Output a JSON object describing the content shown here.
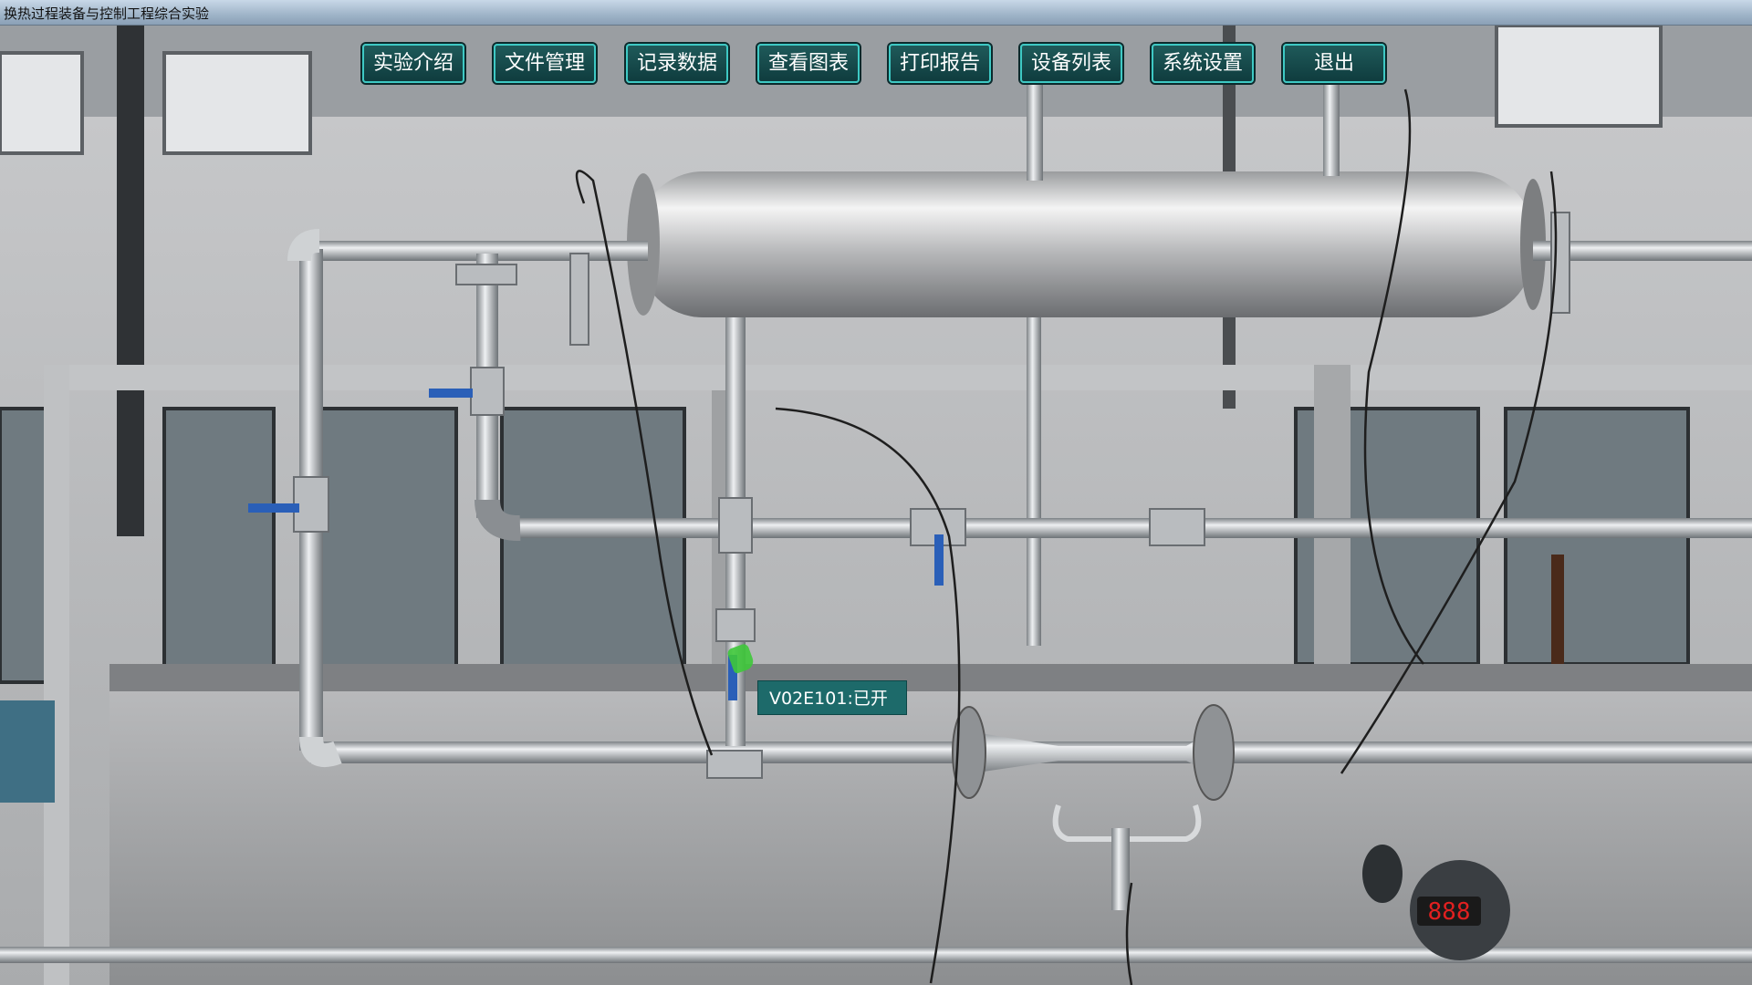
{
  "window": {
    "title": "换热过程装备与控制工程综合实验"
  },
  "toolbar": {
    "buttons": [
      "实验介绍",
      "文件管理",
      "记录数据",
      "查看图表",
      "打印报告",
      "设备列表",
      "系统设置",
      "退出"
    ]
  },
  "valve_tooltip": {
    "text": "V02E101:已开"
  },
  "meter_display": {
    "text": "888"
  },
  "colors": {
    "button_bg": "#154a4c",
    "button_border": "#3ec9c4",
    "tooltip_bg": "#1d6a6a",
    "valve_handle": "#2a5fb8"
  }
}
